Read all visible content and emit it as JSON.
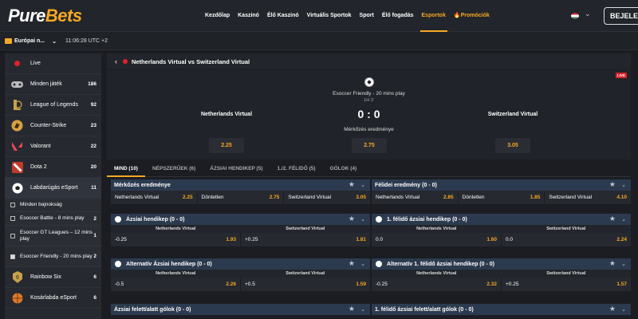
{
  "brand": {
    "logo_main": "Pure",
    "logo_accent": "Bets"
  },
  "nav": {
    "items": [
      "Kezdőlap",
      "Kaszinó",
      "Élő Kaszinó",
      "Virtuális Sportok",
      "Sport",
      "Élő fogadás",
      "Esportok"
    ],
    "promo": "Promóciók",
    "login": "BEJELEN"
  },
  "subbar": {
    "region": "Európai n...",
    "time": "11:06:28 UTC +2"
  },
  "sidebar": {
    "items": [
      {
        "label": "Live",
        "count": "",
        "icon": "live-dot-icon"
      },
      {
        "label": "Minden játék",
        "count": "186",
        "icon": "gamepad-icon"
      },
      {
        "label": "League of Legends",
        "count": "92",
        "icon": "league-of-legends-icon"
      },
      {
        "label": "Counter-Strike",
        "count": "23",
        "icon": "counter-strike-icon"
      },
      {
        "label": "Valorant",
        "count": "22",
        "icon": "valorant-icon"
      },
      {
        "label": "Dota 2",
        "count": "20",
        "icon": "dota2-icon"
      },
      {
        "label": "Labdarúgás eSport",
        "count": "11",
        "icon": "football-icon"
      }
    ],
    "subitems": [
      {
        "label": "Minden bajnokság",
        "count": ""
      },
      {
        "label": "Esoccer Battle - 8 mins play",
        "count": "2"
      },
      {
        "label": "Esoccer GT Leagues – 12 mins play",
        "count": "1"
      },
      {
        "label": "Esoccer Friendly - 20 mins play",
        "count": "2"
      }
    ],
    "items_after": [
      {
        "label": "Rainbow Six",
        "count": "6",
        "icon": "rainbow-six-icon"
      },
      {
        "label": "Kosárlabda eSport",
        "count": "6",
        "icon": "basketball-icon"
      }
    ]
  },
  "match": {
    "title": "Netherlands Virtual vs Switzerland Virtual",
    "live_badge": "LIVE",
    "competition": "Esoccer Friendly - 20 mins play",
    "period": "1H 3'",
    "home": "Netherlands Virtual",
    "away": "Switzerland Virtual",
    "score": "0 : 0",
    "result_label": "Mérkőzés eredménye",
    "odds": {
      "home": "2.25",
      "draw": "2.75",
      "away": "3.05"
    }
  },
  "tabs": [
    "MIND (10)",
    "NÉPSZERŰEK (6)",
    "ÁZSIAI HENDIKEP (5)",
    "1./2. FÉLIDŐ (5)",
    "GÓLOK (4)"
  ],
  "markets": {
    "m1": {
      "title": "Mérkőzés eredménye",
      "cells": [
        {
          "name": "Netherlands Virtual",
          "odd": "2.25"
        },
        {
          "name": "Döntetlen",
          "odd": "2.75"
        },
        {
          "name": "Switzerland Virtual",
          "odd": "3.05"
        }
      ]
    },
    "m2": {
      "title": "Félidei eredmény (0 - 0)",
      "cells": [
        {
          "name": "Netherlands Virtual",
          "odd": "2.85"
        },
        {
          "name": "Döntetlen",
          "odd": "1.85"
        },
        {
          "name": "Switzerland Virtual",
          "odd": "4.10"
        }
      ]
    },
    "m3": {
      "title": "Ázsiai hendikep (0 - 0)",
      "cols": [
        "Netherlands Virtual",
        "Switzerland Virtual"
      ],
      "cells": [
        {
          "name": "-0.25",
          "odd": "1.93"
        },
        {
          "name": "+0.25",
          "odd": "1.81"
        }
      ]
    },
    "m4": {
      "title": "1. félidő ázsiai hendikep (0 - 0)",
      "cols": [
        "Netherlands Virtual",
        "Switzerland Virtual"
      ],
      "cells": [
        {
          "name": "0.0",
          "odd": "1.60"
        },
        {
          "name": "0.0",
          "odd": "2.24"
        }
      ]
    },
    "m5": {
      "title": "Alternatív Ázsiai hendikep (0 - 0)",
      "cols": [
        "Netherlands Virtual",
        "Switzerland Virtual"
      ],
      "cells": [
        {
          "name": "-0.5",
          "odd": "2.26"
        },
        {
          "name": "+0.5",
          "odd": "1.59"
        }
      ]
    },
    "m6": {
      "title": "Alternatív 1. félidő ázsiai hendikep (0 - 0)",
      "cols": [
        "Netherlands Virtual",
        "Switzerland Virtual"
      ],
      "cells": [
        {
          "name": "-0.25",
          "odd": "2.32"
        },
        {
          "name": "+0.25",
          "odd": "1.57"
        }
      ]
    },
    "m7": {
      "title": "Ázsiai felett/alatt gólok (0 - 0)"
    },
    "m8": {
      "title": "1. félidő ázsiai felett/alatt gólok (0 - 0)"
    }
  },
  "colors": {
    "accent": "#f7a823",
    "market_header": "#2c3a4f",
    "live": "#d8232a"
  }
}
